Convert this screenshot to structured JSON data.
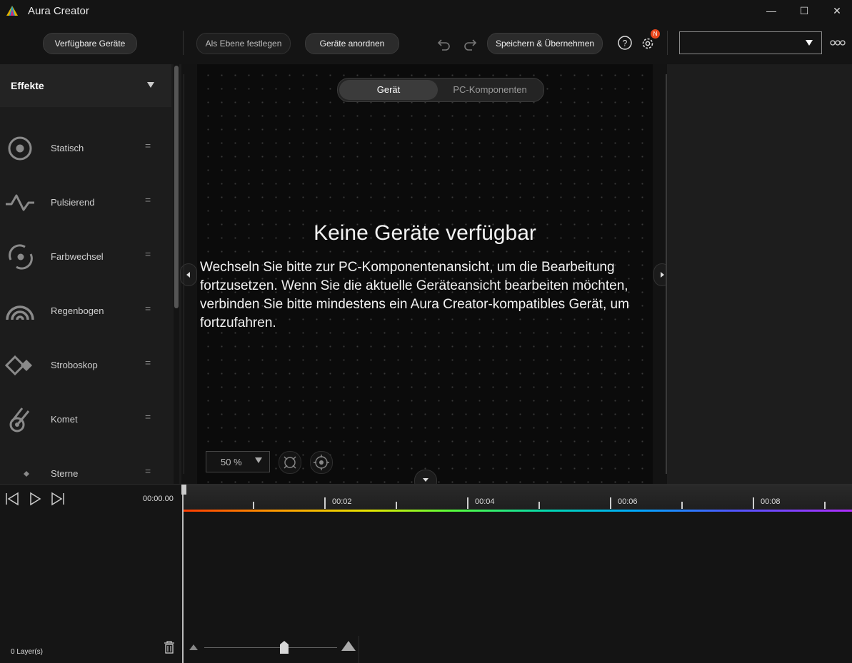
{
  "window": {
    "title": "Aura Creator",
    "minimize": "—",
    "maximize": "☐",
    "close": "✕"
  },
  "toolbar": {
    "available_devices": "Verfügbare Geräte",
    "set_as_layer": "Als Ebene festlegen",
    "arrange_devices": "Geräte anordnen",
    "save_apply": "Speichern & Übernehmen",
    "settings_badge": "N",
    "device_select_value": "",
    "accent_color": "#e8461c"
  },
  "sidebar": {
    "title": "Effekte",
    "items": [
      {
        "label": "Statisch",
        "icon": "static-icon"
      },
      {
        "label": "Pulsierend",
        "icon": "pulse-icon"
      },
      {
        "label": "Farbwechsel",
        "icon": "color-cycle-icon"
      },
      {
        "label": "Regenbogen",
        "icon": "rainbow-icon"
      },
      {
        "label": "Stroboskop",
        "icon": "strobe-icon"
      },
      {
        "label": "Komet",
        "icon": "comet-icon"
      },
      {
        "label": "Sterne",
        "icon": "stars-icon"
      }
    ]
  },
  "canvas": {
    "tabs": [
      "Gerät",
      "PC-Komponenten"
    ],
    "selected_tab": "Gerät",
    "empty_title": "Keine Geräte verfügbar",
    "empty_body": "Wechseln Sie bitte zur PC-Komponentenansicht, um die Bearbeitung fortzusetzen. Wenn Sie die aktuelle Geräteansicht bearbeiten möchten, verbinden Sie bitte mindestens ein Aura Creator-kompatibles Gerät, um fortzufahren.",
    "zoom": "50 %"
  },
  "timeline": {
    "current_time": "00:00.00",
    "tick_labels": [
      "00:02",
      "00:04",
      "00:06",
      "00:08"
    ],
    "layers": "0  Layer(s)",
    "zoom_level": 0.6
  }
}
